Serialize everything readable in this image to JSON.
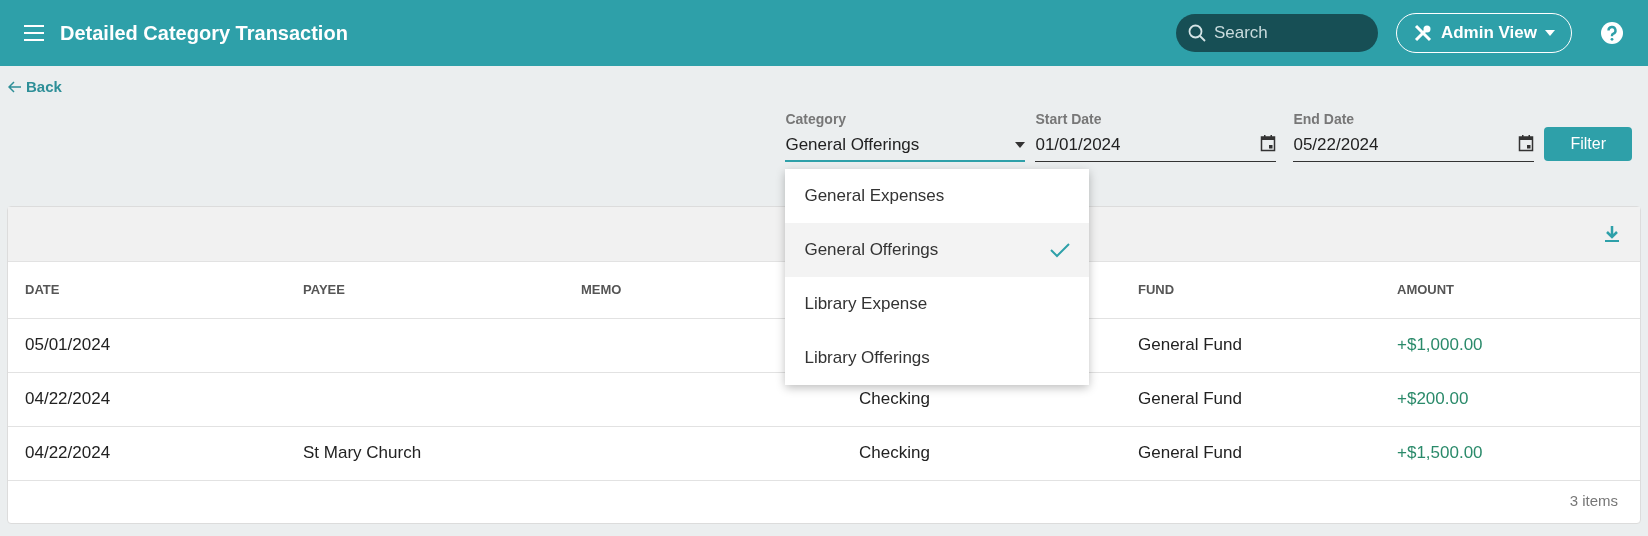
{
  "header": {
    "title": "Detailed Category Transaction",
    "search": {
      "placeholder": "Search"
    },
    "view_button": "Admin View"
  },
  "back_link": "Back",
  "filters": {
    "category": {
      "label": "Category",
      "value": "General Offerings",
      "expanded": true,
      "options": [
        {
          "label": "General Expenses",
          "selected": false
        },
        {
          "label": "General Offerings",
          "selected": true
        },
        {
          "label": "Library Expense",
          "selected": false
        },
        {
          "label": "Library Offerings",
          "selected": false
        }
      ]
    },
    "start_date": {
      "label": "Start Date",
      "value": "01/01/2024"
    },
    "end_date": {
      "label": "End Date",
      "value": "05/22/2024"
    },
    "filter_button": "Filter"
  },
  "table": {
    "columns": [
      "DATE",
      "PAYEE",
      "MEMO",
      "",
      "FUND",
      "AMOUNT"
    ],
    "rows": [
      {
        "cells": [
          "05/01/2024",
          "",
          "",
          "",
          "General Fund",
          "+$1,000.00"
        ]
      },
      {
        "cells": [
          "04/22/2024",
          "",
          "",
          "Checking",
          "General Fund",
          "+$200.00"
        ]
      },
      {
        "cells": [
          "04/22/2024",
          "St Mary Church",
          "",
          "Checking",
          "General Fund",
          "+$1,500.00"
        ]
      }
    ],
    "footer": "3 items"
  }
}
